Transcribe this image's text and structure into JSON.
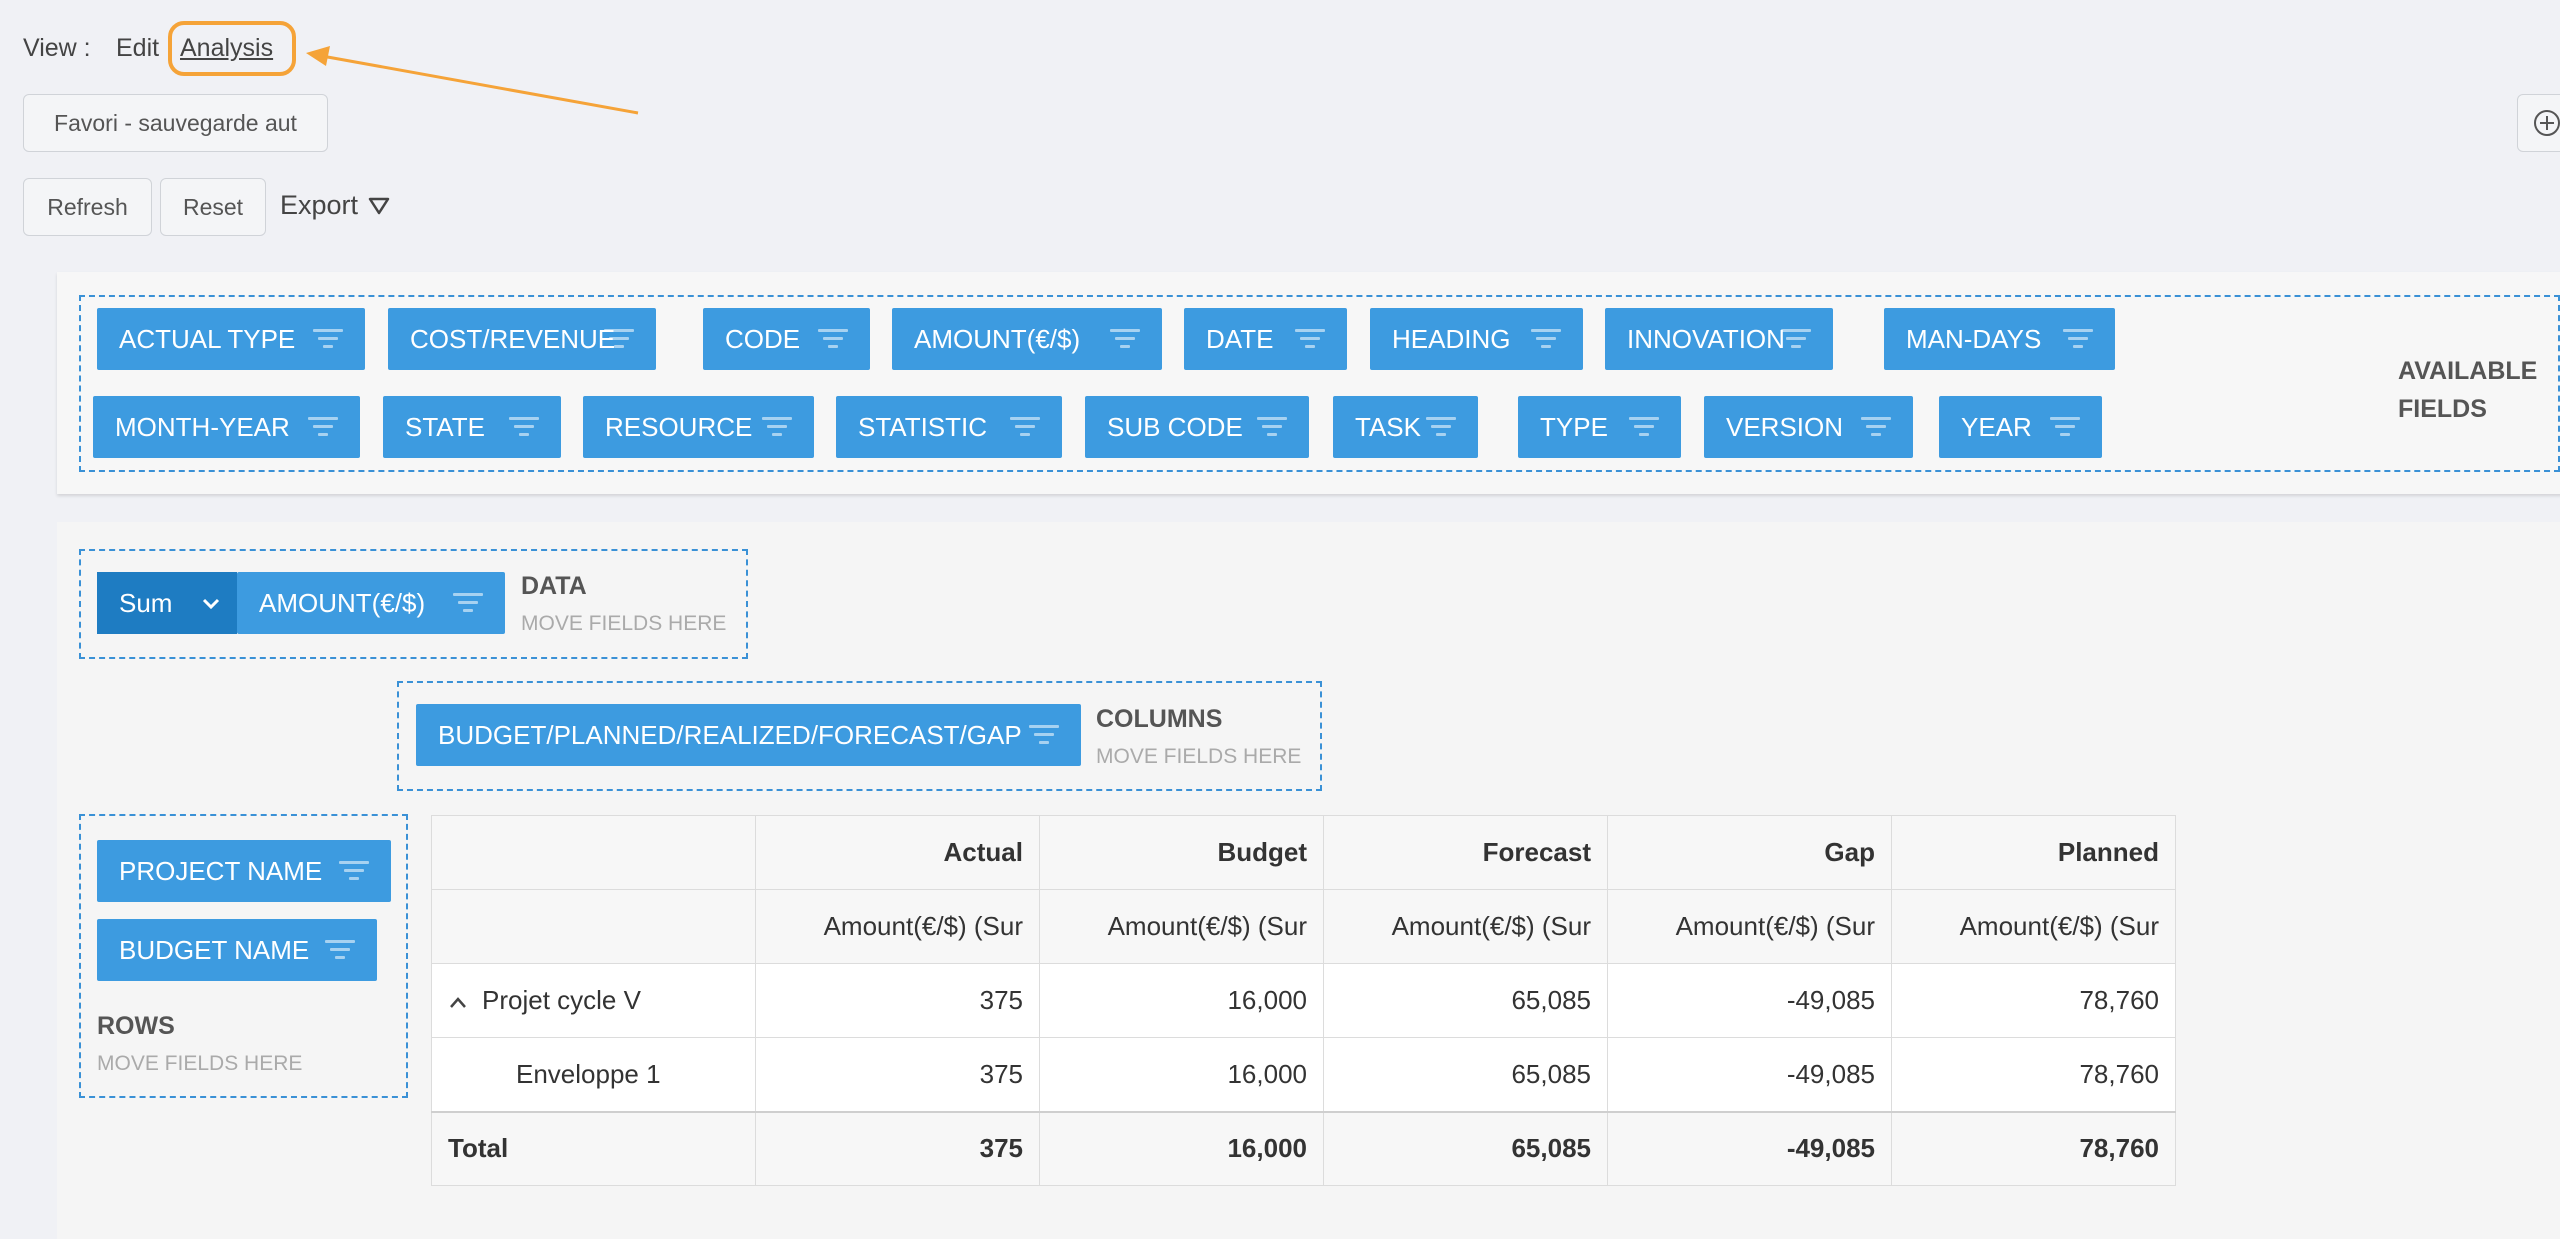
{
  "view": {
    "label": "View :",
    "edit": "Edit",
    "analysis": "Analysis"
  },
  "favorite": {
    "label": "Favori - sauvegarde aut"
  },
  "toolbar": {
    "refresh": "Refresh",
    "reset": "Reset",
    "export": "Export"
  },
  "available_fields": {
    "title_line1": "AVAILABLE",
    "title_line2": "FIELDS",
    "row1": [
      "ACTUAL TYPE",
      "COST/REVENUE",
      "CODE",
      "AMOUNT(€/$)",
      "DATE",
      "HEADING",
      "INNOVATION",
      "MAN-DAYS"
    ],
    "row2": [
      "MONTH-YEAR",
      "STATE",
      "RESOURCE",
      "STATISTIC",
      "SUB CODE",
      "TASK",
      "TYPE",
      "VERSION",
      "YEAR"
    ]
  },
  "data_zone": {
    "aggregator": "Sum",
    "field": "AMOUNT(€/$)",
    "title": "DATA",
    "hint": "MOVE FIELDS HERE"
  },
  "columns_zone": {
    "field": "BUDGET/PLANNED/REALIZED/FORECAST/GAP",
    "title": "COLUMNS",
    "hint": "MOVE FIELDS HERE"
  },
  "rows_zone": {
    "fields": [
      "PROJECT NAME",
      "BUDGET NAME"
    ],
    "title": "ROWS",
    "hint": "MOVE FIELDS HERE"
  },
  "grid": {
    "columns": [
      "Actual",
      "Budget",
      "Forecast",
      "Gap",
      "Planned"
    ],
    "measure": "Amount(€/$) (Sur",
    "rows": [
      {
        "label": "Projet cycle V",
        "values": [
          "375",
          "16,000",
          "65,085",
          "-49,085",
          "78,760"
        ]
      },
      {
        "label": "Enveloppe 1",
        "values": [
          "375",
          "16,000",
          "65,085",
          "-49,085",
          "78,760"
        ]
      }
    ],
    "total": {
      "label": "Total",
      "values": [
        "375",
        "16,000",
        "65,085",
        "-49,085",
        "78,760"
      ]
    }
  },
  "colors": {
    "chip": "#3d9be0",
    "chip_dark": "#1e7cc2",
    "dropzone_border": "#3a91d6",
    "highlight": "#f5a338"
  }
}
